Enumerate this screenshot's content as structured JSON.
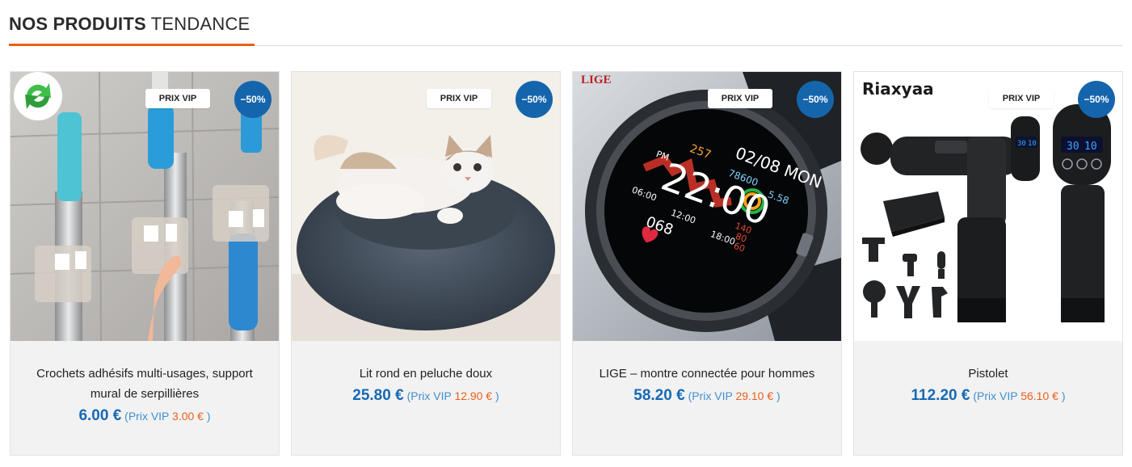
{
  "section": {
    "title_bold": "NOS PRODUITS",
    "title_light": "TENDANCE"
  },
  "products": [
    {
      "title": "Crochets adhésifs multi-usages, support mural de serpillières",
      "price": "6.00 €",
      "vip_label": "(Prix VIP",
      "vip_price": "3.00 €",
      "vip_close": ")",
      "badge": "PRIX VIP",
      "discount": "−50%"
    },
    {
      "title": "Lit rond en peluche doux",
      "price": "25.80 €",
      "vip_label": "(Prix VIP",
      "vip_price": "12.90 €",
      "vip_close": ")",
      "badge": "PRIX VIP",
      "discount": "−50%"
    },
    {
      "title": "LIGE – montre connectée pour hommes",
      "price": "58.20 €",
      "vip_label": "(Prix VIP",
      "vip_price": "29.10 €",
      "vip_close": ")",
      "badge": "PRIX VIP",
      "discount": "−50%",
      "watch": {
        "brand": "LIGE",
        "date": "02/08 MON",
        "pm": "PM",
        "time": "22:00",
        "steps": "78600",
        "kcal": "257",
        "km": "5.58",
        "hr": "068",
        "t1": "06:00",
        "t2": "12:00",
        "t3": "18:00",
        "v1": "140",
        "v2": "80",
        "v3": "60"
      }
    },
    {
      "title": "Pistolet",
      "price": "112.20 €",
      "vip_label": "(Prix VIP",
      "vip_price": "56.10 €",
      "vip_close": ")",
      "badge": "PRIX VIP",
      "discount": "−50%",
      "gun": {
        "brand": "Riaxyaa",
        "display_a": "30",
        "display_b": "10"
      }
    }
  ]
}
